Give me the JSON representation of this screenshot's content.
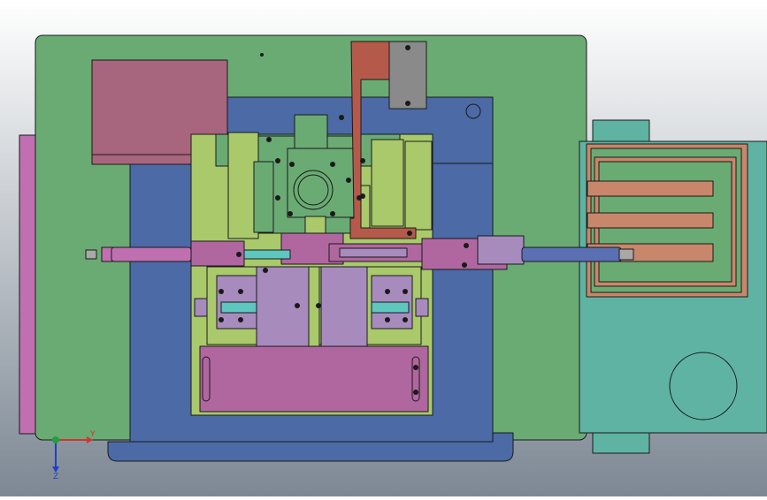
{
  "view": {
    "background_top": "#ffffff",
    "background_bottom": "#7d8894",
    "edge_color": "#1a1a1a"
  },
  "palette": {
    "base_green": "#6aab74",
    "plate_blue": "#4b6aa6",
    "pink": "#a8657e",
    "lime": "#a9c96b",
    "lavender": "#a78bbd",
    "magenta": "#b067a0",
    "teal": "#5fb3a3",
    "salmon": "#c8876a",
    "rust": "#b55a4b",
    "grey": "#8a8a8a",
    "rod_blue": "#5b6fb3",
    "cyan": "#5fc6c0",
    "side_pink": "#c070b0"
  },
  "triad": {
    "x_label": "Y",
    "y_label": "Z",
    "x_color": "#d83030",
    "y_color": "#2040c0",
    "origin_color": "#20a040"
  }
}
